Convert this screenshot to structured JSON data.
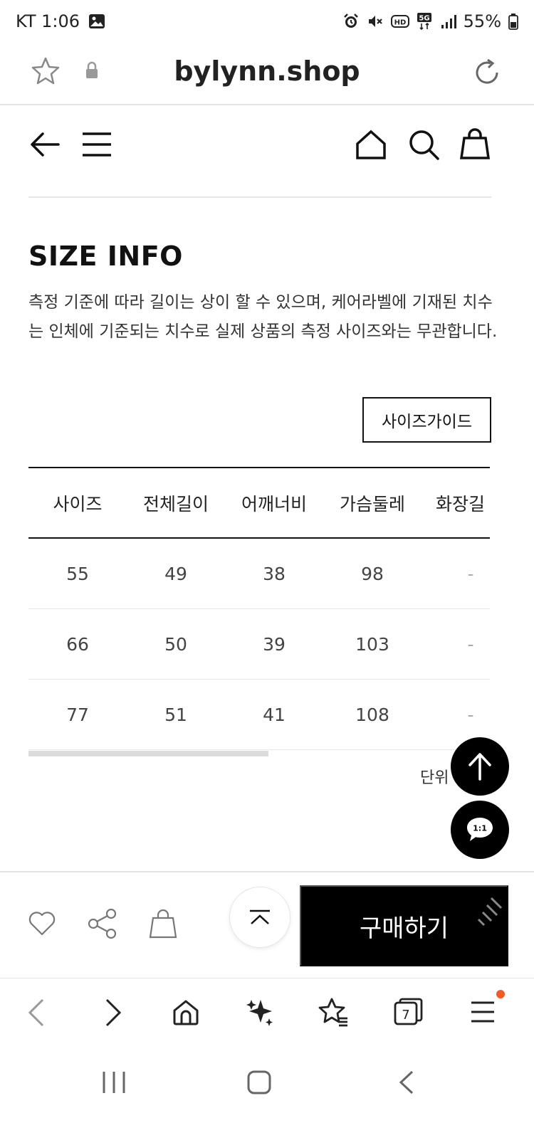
{
  "status_bar": {
    "carrier_time": "KT 1:06",
    "battery": "55%",
    "icons": [
      "gallery-icon",
      "alarm-icon",
      "mute-icon",
      "hd-icon",
      "5g-icon",
      "signal-icon",
      "battery-icon"
    ]
  },
  "url_bar": {
    "url": "bylynn.shop"
  },
  "section": {
    "title": "SIZE INFO",
    "description": "측정 기준에 따라 길이는 상이 할 수 있으며, 케어라벨에 기재된 치수는 인체에 기준되는 치수로 실제 상품의 측정 사이즈와는 무관합니다.",
    "guide_button": "사이즈가이드"
  },
  "size_table": {
    "headers": [
      "사이즈",
      "전체길이",
      "어깨너비",
      "가슴둘레",
      "화장길"
    ],
    "rows": [
      [
        "55",
        "49",
        "38",
        "98",
        "-"
      ],
      [
        "66",
        "50",
        "39",
        "103",
        "-"
      ],
      [
        "77",
        "51",
        "41",
        "108",
        "-"
      ]
    ],
    "scroll_position": 0.52
  },
  "unit_label": "단위",
  "bottom_bar": {
    "buy_label": "구매하기"
  },
  "chat_label": "1:1",
  "tabs_count": "7",
  "colors": {
    "accent": "#000000",
    "notification_dot": "#f05a24"
  }
}
